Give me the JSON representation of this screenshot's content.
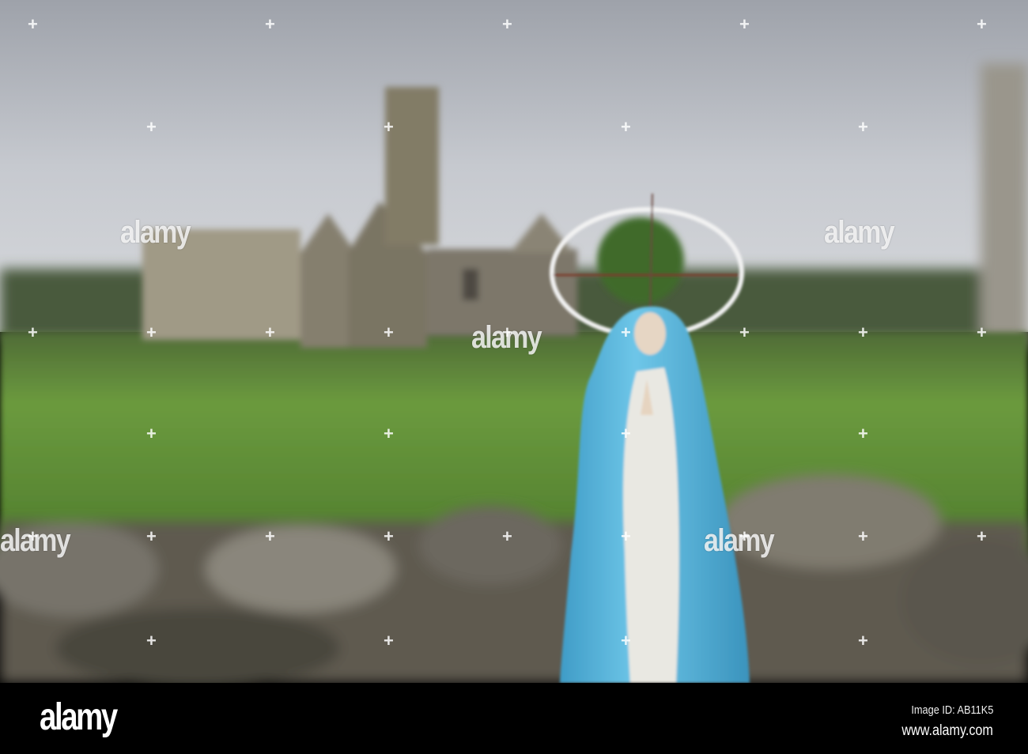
{
  "watermark": {
    "text": "alamy"
  },
  "footer": {
    "logo": "alamy",
    "image_id": "Image ID: AB11K5",
    "url": "www.alamy.com"
  },
  "colors": {
    "sky": "#c9ccd2",
    "grass": "#5d8a35",
    "robe": "#5fb8dd",
    "stone": "#6f6a5e",
    "footer_bg": "#000000"
  }
}
